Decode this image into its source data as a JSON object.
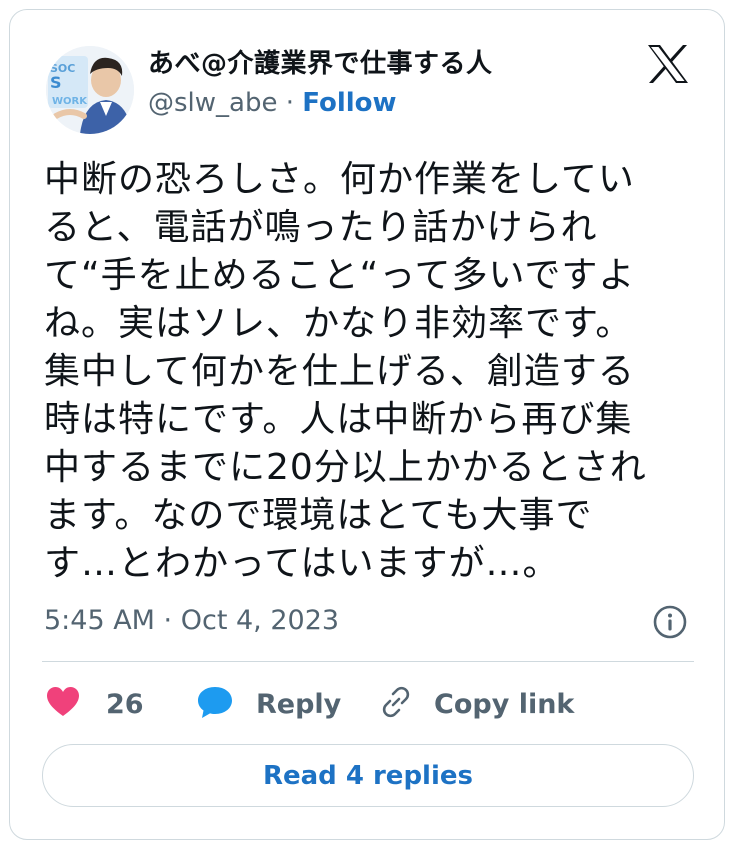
{
  "author": {
    "display_name": "あべ@介護業界で仕事する人",
    "handle": "@slw_abe",
    "separator": "·",
    "follow_label": "Follow",
    "avatar_badge_text": "SOCIAL WORK"
  },
  "tweet": {
    "lines": [
      "中断の恐ろしさ。何か作業をしてい",
      "ると、電話が鳴ったり話かけられ",
      "て“手を止めること“って多いですよ",
      "ね。実はソレ、かなり非効率です。",
      "集中して何かを仕上げる、創造する",
      "時は特にです。人は中断から再び集",
      "中するまでに20分以上かかるとされ",
      "ます。なので環境はとても大事で",
      "す…とわかってはいますが…。"
    ],
    "timestamp": "5:45 AM · Oct 4, 2023"
  },
  "actions": {
    "like_count": "26",
    "reply_label": "Reply",
    "copy_label": "Copy link",
    "read_replies_label": "Read 4 replies"
  },
  "icons": {
    "platform": "x-logo-icon",
    "info": "info-icon",
    "like": "heart-icon",
    "reply": "speech-bubble-icon",
    "copy": "link-icon"
  },
  "colors": {
    "accent": "#1d72c4",
    "heart": "#f0417b",
    "reply_bubble": "#1d9bf0",
    "muted_text": "#536471",
    "border": "#cfd9de"
  }
}
